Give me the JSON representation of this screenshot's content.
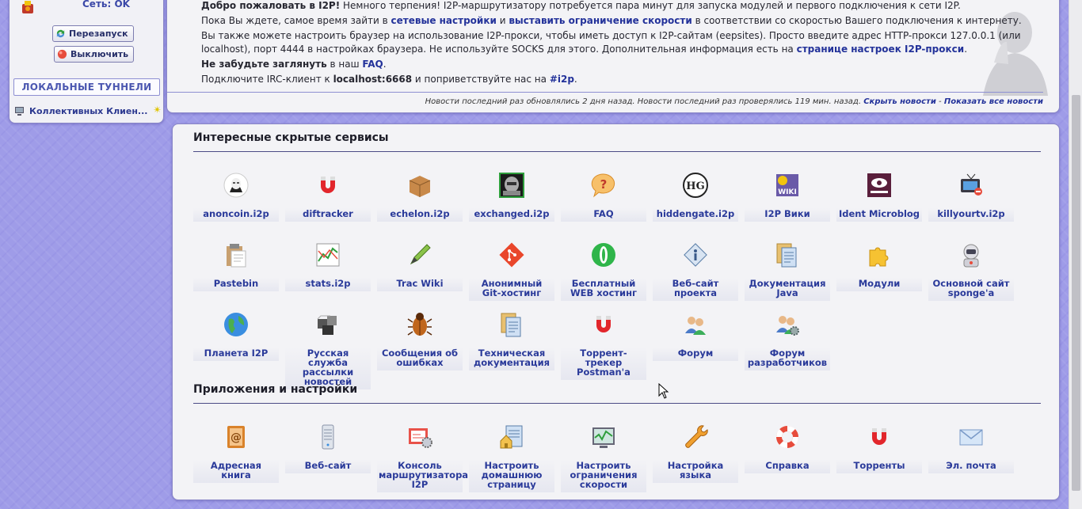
{
  "sidebar": {
    "network_status": "Сеть: OK",
    "restart_button": "Перезапуск",
    "shutdown_button": "Выключить",
    "local_tunnels_title": "ЛОКАЛЬНЫЕ ТУННЕЛИ",
    "tunnels": [
      {
        "label": "Коллективных Клиен..."
      }
    ]
  },
  "news": {
    "welcome_bold": "Добро пожаловать в I2P!",
    "welcome_rest": " Немного терпения! I2P-маршрутизатору потребуется пара минут для запуска модулей и первого подключения к сети I2P.",
    "line2_a": "Пока Вы ждете, самое время зайти в ",
    "line2_link1": "сетевые настройки",
    "line2_b": " и ",
    "line2_link2": "выставить ограничение скорости",
    "line2_c": " в соответствии со скоростью Вашего подключения к интернету.",
    "line3_a": "Вы также можете настроить браузер на использование I2P-прокси, чтобы иметь доступ к I2P-сайтам (eepsites). Просто введите адрес HTTP-прокси 127.0.0.1 (или localhost), порт 4444 в настройках браузера. Не используйте SOCKS для этого. Дополнительная информация есть на ",
    "line3_link": "странице настроек I2P-прокси",
    "line3_b": ".",
    "line4_bold": "Не забудьте заглянуть",
    "line4_a": " в наш ",
    "line4_link": "FAQ",
    "line4_b": ".",
    "line5_a": "Подключите IRC-клиент к ",
    "line5_bold": "localhost:6668",
    "line5_b": " и поприветствуйте нас на ",
    "line5_link": "#i2p",
    "line5_c": ".",
    "footer_text": "Новости последний раз обновлялись 2 дня назад. Новости последний раз проверялись 119 мин. назад.",
    "hide_link": "Скрыть новости",
    "separator": " - ",
    "show_all_link": "Показать все новости"
  },
  "services": {
    "title": "Интересные скрытые сервисы",
    "items": [
      {
        "label": "anoncoin.i2p",
        "icon": "anonymous-mask-icon"
      },
      {
        "label": "diftracker",
        "icon": "magnet-icon"
      },
      {
        "label": "echelon.i2p",
        "icon": "box-icon"
      },
      {
        "label": "exchanged.i2p",
        "icon": "robot-icon"
      },
      {
        "label": "FAQ",
        "icon": "question-bubble-icon"
      },
      {
        "label": "hiddengate.i2p",
        "icon": "hg-logo-icon"
      },
      {
        "label": "I2P Вики",
        "icon": "wiki-icon"
      },
      {
        "label": "Ident Microblog",
        "icon": "ident-eye-icon"
      },
      {
        "label": "killyourtv.i2p",
        "icon": "tv-icon"
      },
      {
        "label": "Pastebin",
        "icon": "clipboard-icon"
      },
      {
        "label": "stats.i2p",
        "icon": "chart-icon"
      },
      {
        "label": "Trac Wiki",
        "icon": "pen-icon"
      },
      {
        "label": "Анонимный Git-хостинг",
        "icon": "git-icon"
      },
      {
        "label": "Бесплатный WEB хостинг",
        "icon": "green-o-icon"
      },
      {
        "label": "Веб-сайт проекта",
        "icon": "info-diamond-icon"
      },
      {
        "label": "Документация Java",
        "icon": "documents-icon"
      },
      {
        "label": "Модули",
        "icon": "puzzle-icon"
      },
      {
        "label": "Основной сайт sponge'a",
        "icon": "astronaut-icon"
      },
      {
        "label": "Планета I2P",
        "icon": "globe-icon"
      },
      {
        "label": "Русская служба рассылки новостей",
        "icon": "cubes-icon"
      },
      {
        "label": "Сообщения об ошибках",
        "icon": "bug-icon"
      },
      {
        "label": "Техническая документация",
        "icon": "documents-icon"
      },
      {
        "label": "Торрент-трекер Postman'a",
        "icon": "magnet-icon"
      },
      {
        "label": "Форум",
        "icon": "users-icon"
      },
      {
        "label": "Форум разработчиков",
        "icon": "users-gear-icon"
      }
    ]
  },
  "apps": {
    "title": "Приложения и настройки",
    "items": [
      {
        "label": "Адресная книга",
        "icon": "address-book-icon"
      },
      {
        "label": "Веб-сайт",
        "icon": "server-icon"
      },
      {
        "label": "Консоль маршрутизатора I2P",
        "icon": "console-icon"
      },
      {
        "label": "Настроить домашнюю страницу",
        "icon": "home-page-icon"
      },
      {
        "label": "Настроить ограничения скорости",
        "icon": "monitor-graph-icon"
      },
      {
        "label": "Настройка языка",
        "icon": "wrench-icon"
      },
      {
        "label": "Справка",
        "icon": "lifebuoy-icon"
      },
      {
        "label": "Торренты",
        "icon": "magnet-icon"
      },
      {
        "label": "Эл. почта",
        "icon": "envelope-icon"
      }
    ]
  },
  "colors": {
    "background": "#9f9ce8",
    "panel": "#f3f3f6",
    "link": "#23329a"
  }
}
